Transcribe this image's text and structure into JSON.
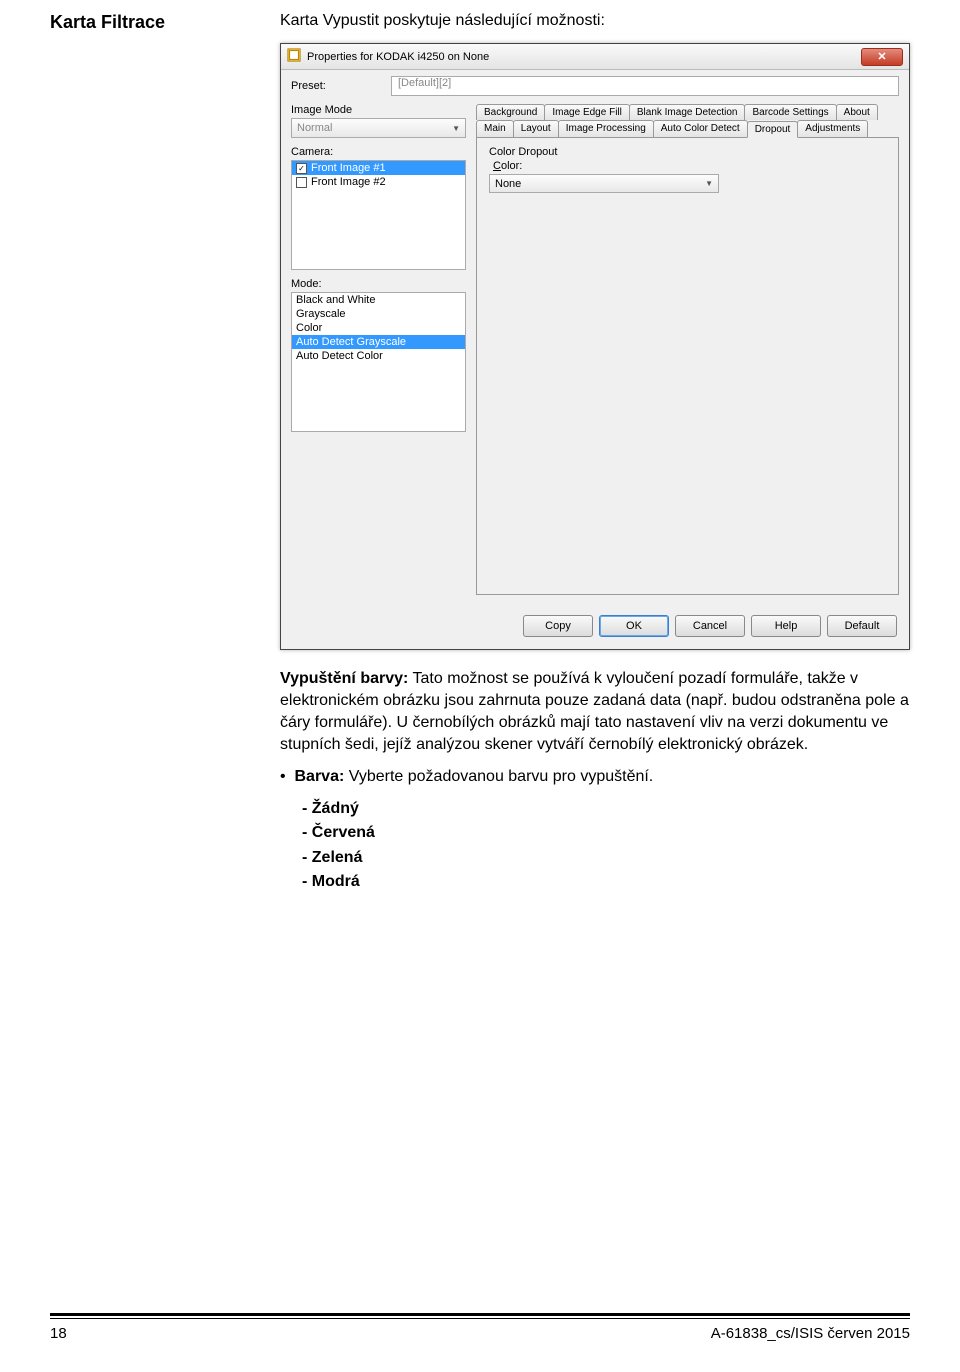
{
  "doc": {
    "section_title": "Karta Filtrace",
    "intro": "Karta Vypustit poskytuje následující možnosti:",
    "para1_lead": "Vypuštění barvy:",
    "para1_body": " Tato možnost se používá k vyloučení pozadí formuláře, takže v elektronickém obrázku jsou zahrnuta pouze zadaná data (např. budou odstraněna pole a čáry formuláře). U černobílých obrázků mají tato nastavení vliv na verzi dokumentu ve stupních šedi, jejíž analýzou skener vytváří černobílý elektronický obrázek.",
    "bullet_lead": "Barva:",
    "bullet_body": " Vyberte požadovanou barvu pro vypuštění.",
    "options": [
      "Žádný",
      "Červená",
      "Zelená",
      "Modrá"
    ],
    "page_number": "18",
    "footer_right": "A-61838_cs/ISIS  červen 2015"
  },
  "dialog": {
    "title": "Properties for KODAK i4250 on None",
    "preset_label": "Preset:",
    "preset_value": "[Default][2]",
    "image_mode_label": "Image Mode",
    "image_mode_value": "Normal",
    "camera_label": "Camera:",
    "camera_items": [
      {
        "label": "Front Image #1",
        "checked": true,
        "selected": true
      },
      {
        "label": "Front Image #2",
        "checked": false,
        "selected": false
      }
    ],
    "mode_label": "Mode:",
    "mode_items": [
      {
        "label": "Black and White",
        "selected": false
      },
      {
        "label": "Grayscale",
        "selected": false
      },
      {
        "label": "Color",
        "selected": false
      },
      {
        "label": "Auto Detect Grayscale",
        "selected": true
      },
      {
        "label": "Auto Detect Color",
        "selected": false
      }
    ],
    "tabs_row1": [
      "Background",
      "Image Edge Fill",
      "Blank Image Detection",
      "Barcode Settings",
      "About"
    ],
    "tabs_row2": [
      "Main",
      "Layout",
      "Image Processing",
      "Auto Color Detect",
      "Dropout",
      "Adjustments"
    ],
    "active_tab": "Dropout",
    "color_dropout_label": "Color Dropout",
    "color_label": "Color:",
    "color_value": "None",
    "buttons": {
      "copy": "Copy",
      "ok": "OK",
      "cancel": "Cancel",
      "help": "Help",
      "default": "Default"
    }
  }
}
